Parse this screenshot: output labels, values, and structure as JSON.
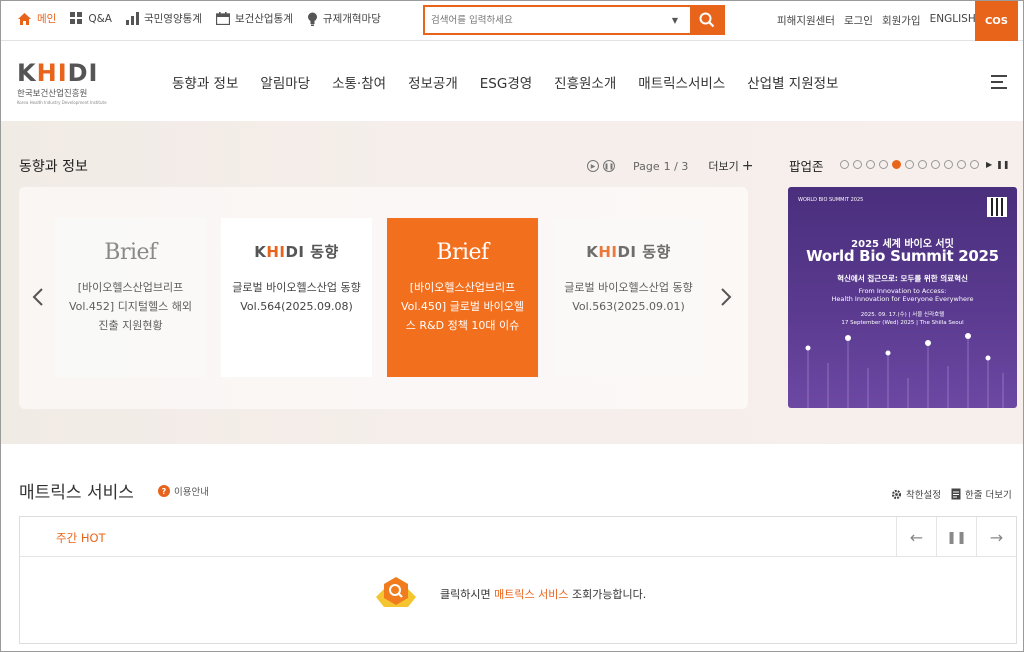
{
  "util": {
    "links": [
      {
        "label": "메인",
        "icon": "home-icon",
        "active": true
      },
      {
        "label": "Q&A",
        "icon": "grid-icon",
        "active": false
      },
      {
        "label": "국민영양통계",
        "icon": "bar-chart-icon",
        "active": false
      },
      {
        "label": "보건산업통계",
        "icon": "calendar-icon",
        "active": false
      },
      {
        "label": "규제개혁마당",
        "icon": "lightbulb-icon",
        "active": false
      }
    ],
    "search_placeholder": "검색어를 입력하세요",
    "member_links": [
      "피해지원센터",
      "로그인",
      "회원가입",
      "ENGLISH"
    ],
    "cos_label": "COS"
  },
  "logo": {
    "mark_a": "K",
    "mark_hi": "HI",
    "mark_b": "DI",
    "kor": "한국보건산업진흥원",
    "eng": "Korea Health Industry Development Institute"
  },
  "gnb": [
    "동향과 정보",
    "알림마당",
    "소통·참여",
    "정보공개",
    "ESG경영",
    "진흥원소개",
    "매트릭스서비스",
    "산업별 지원정보"
  ],
  "trend": {
    "title": "동향과 정보",
    "page_label": "Page",
    "page_value": "1 / 3",
    "more_label": "더보기",
    "cards": [
      {
        "logo": "Brief",
        "text": "[바이오헬스산업브리프 Vol.452] 디지털헬스 해외진출 지원현황"
      },
      {
        "logo": "KHIDI 동향",
        "text": "글로벌 바이오헬스산업 동향 Vol.564(2025.09.08)"
      },
      {
        "logo": "Brief",
        "text": "[바이오헬스산업브리프 Vol.450] 글로벌 바이오헬스 R&D 정책 10대 이슈"
      },
      {
        "logo": "KHIDI 동향",
        "text": "글로벌 바이오헬스산업 동향 Vol.563(2025.09.01)"
      }
    ],
    "trend_logo_a": "K",
    "trend_logo_hi": "HI",
    "trend_logo_b": "DI 동향"
  },
  "popup": {
    "title": "팝업존",
    "dot_count": 11,
    "active_dot": 4,
    "banner": {
      "logo": "WORLD BIO SUMMIT 2025",
      "subtitle": "2025 세계 바이오 서밋",
      "title": "World Bio Summit 2025",
      "tag_kor": "혁신에서 접근으로: 모두를 위한 의료혁신",
      "tag_eng_1": "From Innovation to Access:",
      "tag_eng_2": "Health Innovation for Everyone Everywhere",
      "date_kor": "2025. 09. 17.(수) | 서울 신라호텔",
      "date_eng": "17 September (Wed) 2025 | The Shilla Seoul"
    }
  },
  "matrix": {
    "title": "매트릭스 서비스",
    "guide_label": "이용안내",
    "settings_label": "착한설정",
    "more_label": "한줄 더보기",
    "hot_label": "주간 HOT",
    "notice_pre": "클릭하시면",
    "notice_hl": "매트릭스 서비스",
    "notice_post": "조회가능합니다."
  },
  "colors": {
    "accent": "#e8641b",
    "banner": "#4a2f7d"
  }
}
